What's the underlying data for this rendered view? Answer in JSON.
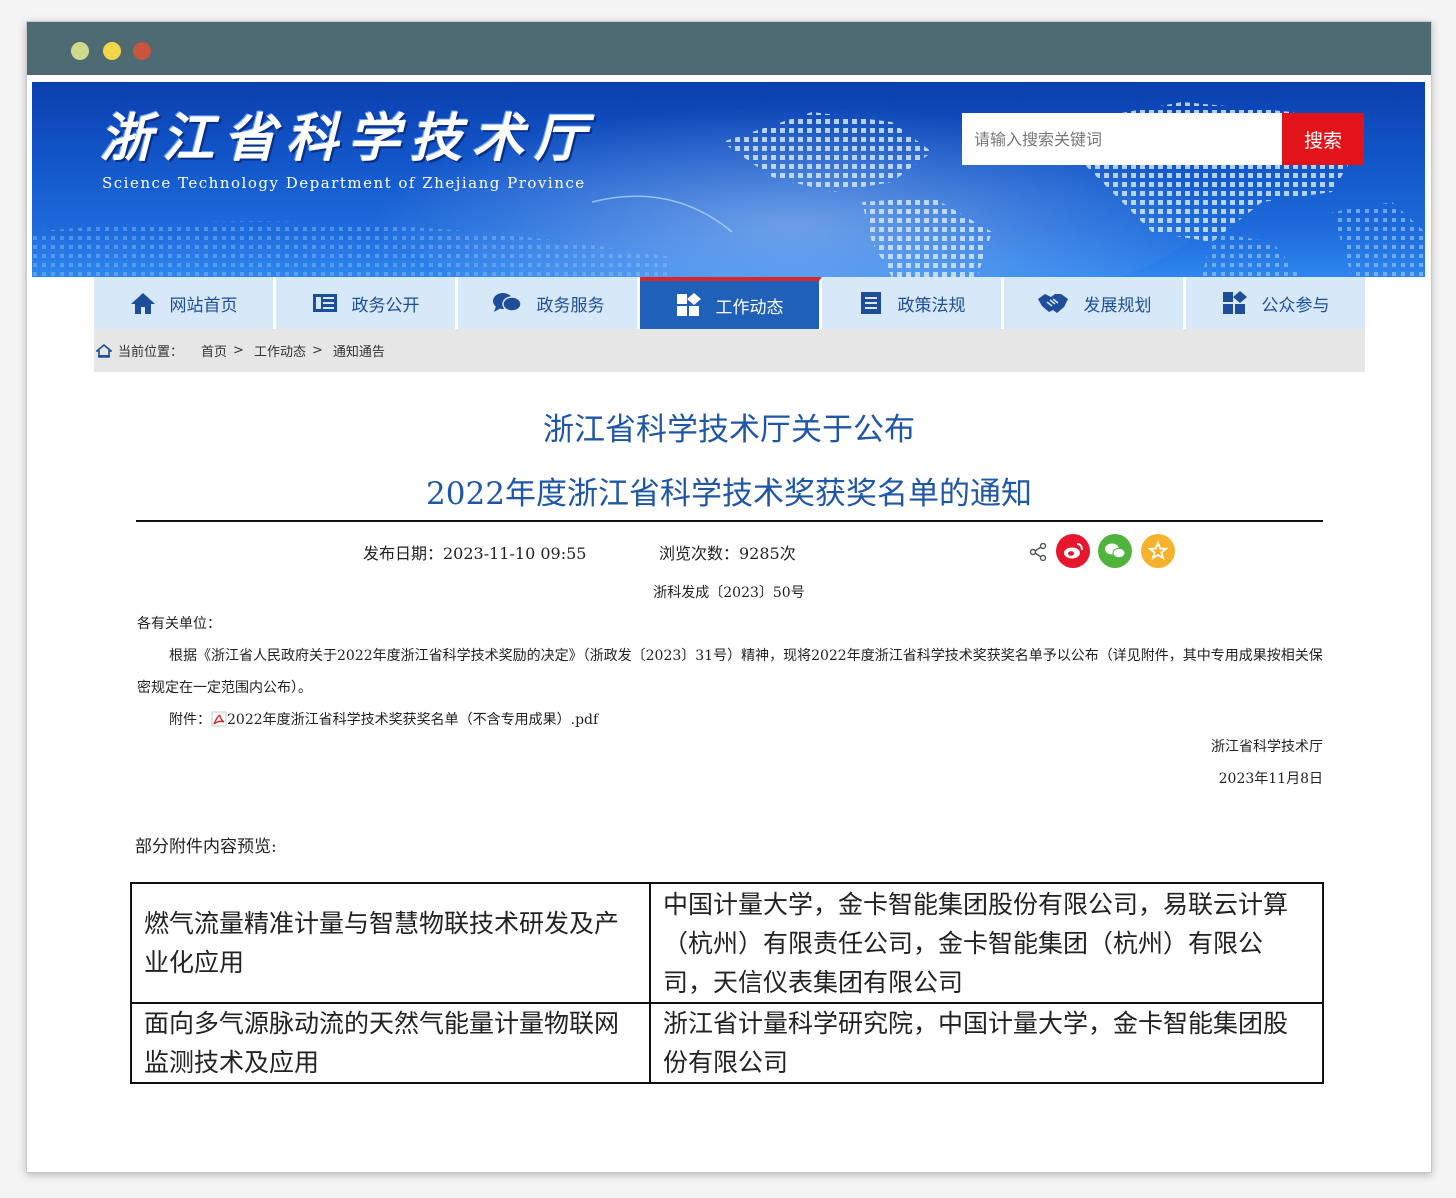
{
  "window": {
    "controls": [
      "close",
      "minimize",
      "maximize"
    ]
  },
  "header": {
    "site_title": "浙江省科学技术厅",
    "site_subtitle": "Science Technology Department of Zhejiang Province",
    "search_placeholder": "请输入搜索关键词",
    "search_button": "搜索"
  },
  "nav": {
    "items": [
      {
        "label": "网站首页",
        "icon": "home-icon"
      },
      {
        "label": "政务公开",
        "icon": "list-icon"
      },
      {
        "label": "政务服务",
        "icon": "chat-icon"
      },
      {
        "label": "工作动态",
        "icon": "diamond-icon",
        "active": true
      },
      {
        "label": "政策法规",
        "icon": "document-icon"
      },
      {
        "label": "发展规划",
        "icon": "handshake-icon"
      },
      {
        "label": "公众参与",
        "icon": "diamond-icon"
      }
    ]
  },
  "breadcrumb": {
    "prefix": "当前位置：",
    "items": [
      "首页",
      "工作动态",
      "通知通告"
    ],
    "separator": ">"
  },
  "article": {
    "title_line1": "浙江省科学技术厅关于公布",
    "title_line2": "2022年度浙江省科学技术奖获奖名单的通知",
    "publish_date": "发布日期：2023-11-10 09:55",
    "views": "浏览次数：9285次",
    "doc_number": "浙科发成〔2023〕50号",
    "salutation": "各有关单位：",
    "paragraph": "根据《浙江省人民政府关于2022年度浙江省科学技术奖励的决定》（浙政发〔2023〕31号）精神，现将2022年度浙江省科学技术奖获奖名单予以公布（详见附件，其中专用成果按相关保密规定在一定范围内公布）。",
    "attachment_label": "附件：",
    "attachment_file": "2022年度浙江省科学技术奖获奖名单（不含专用成果）.pdf",
    "signature": "浙江省科学技术厅",
    "sign_date": "2023年11月8日"
  },
  "share": {
    "icons": [
      "share-icon",
      "weibo-icon",
      "wechat-icon",
      "favorite-icon"
    ],
    "colors": {
      "weibo": "#e6162d",
      "wechat": "#50b43c",
      "favorite": "#f5b32d"
    }
  },
  "preview": {
    "label": "部分附件内容预览:",
    "rows": [
      {
        "project": "燃气流量精准计量与智慧物联技术研发及产业化应用",
        "units": "中国计量大学，金卡智能集团股份有限公司，易联云计算（杭州）有限责任公司，金卡智能集团（杭州）有限公司，天信仪表集团有限公司"
      },
      {
        "project": "面向多气源脉动流的天然气能量计量物联网监测技术及应用",
        "units": "浙江省计量科学研究院，中国计量大学，金卡智能集团股份有限公司"
      }
    ]
  },
  "colors": {
    "titlebar": "#4e6a72",
    "nav_active": "#1f60b8",
    "nav_bg": "#d7e8f9",
    "title_blue": "#1f56a6",
    "search_red": "#e2141a"
  }
}
